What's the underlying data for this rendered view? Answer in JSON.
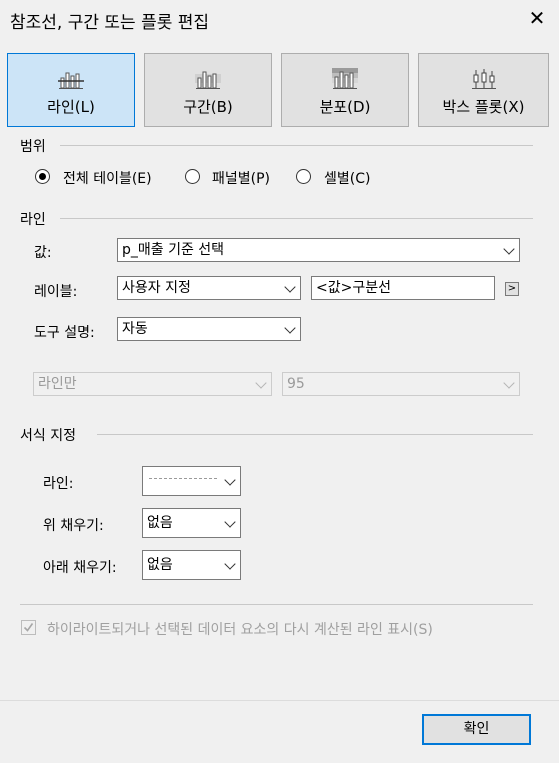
{
  "window": {
    "title": "참조선, 구간 또는 플롯 편집",
    "close_glyph": "✕"
  },
  "tabs": [
    {
      "label": "라인(L)",
      "icon": "line-chart-icon",
      "selected": true
    },
    {
      "label": "구간(B)",
      "icon": "band-chart-icon",
      "selected": false
    },
    {
      "label": "분포(D)",
      "icon": "distribution-chart-icon",
      "selected": false
    },
    {
      "label": "박스 플롯(X)",
      "icon": "box-plot-icon",
      "selected": false
    }
  ],
  "scope": {
    "heading": "범위",
    "options": [
      {
        "label": "전체 테이블(E)",
        "selected": true
      },
      {
        "label": "패널별(P)",
        "selected": false
      },
      {
        "label": "셀별(C)",
        "selected": false
      }
    ]
  },
  "line": {
    "heading": "라인",
    "value_label": "값:",
    "value_select": "p_매출 기준 선택",
    "label_label": "레이블:",
    "label_select": "사용자 지정",
    "label_text": "<값>구분선",
    "label_insert_glyph": ">",
    "tooltip_label": "도구 설명:",
    "tooltip_select": "자동",
    "mode_select": "라인만",
    "percent_select": "95"
  },
  "format": {
    "heading": "서식 지정",
    "line_label": "라인:",
    "above_label": "위 채우기:",
    "above_select": "없음",
    "below_label": "아래 채우기:",
    "below_select": "없음"
  },
  "recalc": {
    "label": "하이라이트되거나 선택된 데이터 요소의 다시 계산된 라인 표시(S)",
    "checked": true
  },
  "ok_button": "확인",
  "colors": {
    "accent": "#0078d7",
    "selected_tab": "#cce4f7"
  }
}
